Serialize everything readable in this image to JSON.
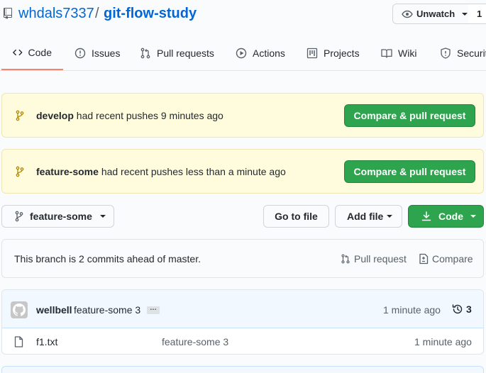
{
  "repo": {
    "owner": "whdals7337",
    "separator": "/",
    "name": "git-flow-study"
  },
  "watch": {
    "label": "Unwatch",
    "count": "1"
  },
  "tabs": [
    {
      "label": "Code",
      "icon": "code-icon"
    },
    {
      "label": "Issues",
      "icon": "issue-icon"
    },
    {
      "label": "Pull requests",
      "icon": "pull-request-icon"
    },
    {
      "label": "Actions",
      "icon": "play-icon"
    },
    {
      "label": "Projects",
      "icon": "project-icon"
    },
    {
      "label": "Wiki",
      "icon": "book-icon"
    },
    {
      "label": "Security",
      "icon": "shield-icon"
    }
  ],
  "banners": [
    {
      "branch": "develop",
      "message": "had recent pushes 9 minutes ago",
      "button": "Compare & pull request"
    },
    {
      "branch": "feature-some",
      "message": "had recent pushes less than a minute ago",
      "button": "Compare & pull request"
    }
  ],
  "toolbar": {
    "branch": "feature-some",
    "goto_file": "Go to file",
    "add_file": "Add file",
    "code": "Code"
  },
  "ahead": {
    "text": "This branch is 2 commits ahead of master.",
    "pull_request": "Pull request",
    "compare": "Compare"
  },
  "commit": {
    "author": "wellbell",
    "message": "feature-some 3",
    "ellipsis": "…",
    "time": "1 minute ago",
    "count": "3"
  },
  "files": [
    {
      "name": "f1.txt",
      "commit": "feature-some 3",
      "time": "1 minute ago"
    }
  ],
  "colors": {
    "link": "#0366d6",
    "green": "#2ea44f",
    "banner_bg": "#fffbdd",
    "active_tab": "#f9826c"
  }
}
